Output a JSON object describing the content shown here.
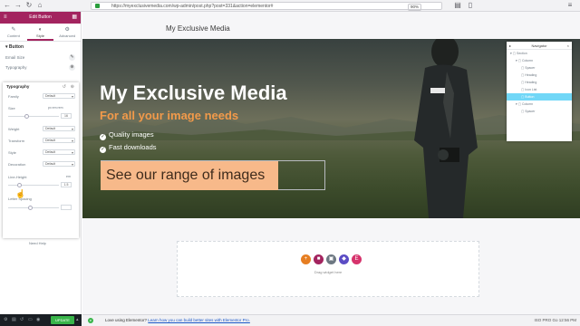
{
  "browser": {
    "url": "https://myexclusivemedia.com/wp-admin/post.php?post=331&action=elementor#",
    "zoom": "90%",
    "icons": [
      "back-icon",
      "forward-icon",
      "reload-icon",
      "home-icon",
      "menu-icon"
    ]
  },
  "panel": {
    "title": "Edit Button",
    "tabs": [
      {
        "label": "Content",
        "icon": "pencil-icon"
      },
      {
        "label": "Style",
        "icon": "half-circle-icon"
      },
      {
        "label": "Advanced",
        "icon": "gear-icon"
      }
    ],
    "section": "Button",
    "text_color_label": "Email Size",
    "typography_label": "Typography",
    "popover": {
      "title": "Typography",
      "family_label": "Family",
      "family_value": "Default",
      "size_label": "Size",
      "size_units": "px em rem",
      "size_value": "16",
      "weight_label": "Weight",
      "weight_value": "Default",
      "transform_label": "Transform",
      "transform_value": "Default",
      "style_label": "Style",
      "style_value": "Default",
      "decoration_label": "Decoration",
      "decoration_value": "Default",
      "line_height_label": "Line-Height",
      "line_height_units": "em",
      "line_height_value": "1.5",
      "letter_spacing_label": "Letter Spacing"
    },
    "need_help": "Need Help",
    "update_label": "UPDATE"
  },
  "page": {
    "site_title": "My Exclusive Media",
    "hero_title": "My Exclusive Media",
    "hero_subtitle": "For all your image needs",
    "features": [
      "Quality images",
      "Fast downloads"
    ],
    "cta": "See our range of images",
    "drag_text": "Drag widget here"
  },
  "navigator": {
    "title": "Navigator",
    "items": [
      {
        "label": "Section",
        "indent": 0
      },
      {
        "label": "Column",
        "indent": 1
      },
      {
        "label": "Spacer",
        "indent": 2
      },
      {
        "label": "Heading",
        "indent": 2
      },
      {
        "label": "Heading",
        "indent": 2
      },
      {
        "label": "Icon List",
        "indent": 2
      },
      {
        "label": "Button",
        "indent": 2,
        "selected": true
      },
      {
        "label": "Column",
        "indent": 1
      },
      {
        "label": "Spacer",
        "indent": 2
      }
    ]
  },
  "statusbar": {
    "message": "Love using Elementor?",
    "link": "Learn how you can build better sites with Elementor Pro.",
    "right": "ISO PRO    Go 12:56 PM"
  },
  "colors": {
    "accent": "#a3245f",
    "cta_bg": "#f7b98a",
    "subtitle": "#f29a4a",
    "update": "#39b54a",
    "nav_selected": "#71d7f7"
  }
}
